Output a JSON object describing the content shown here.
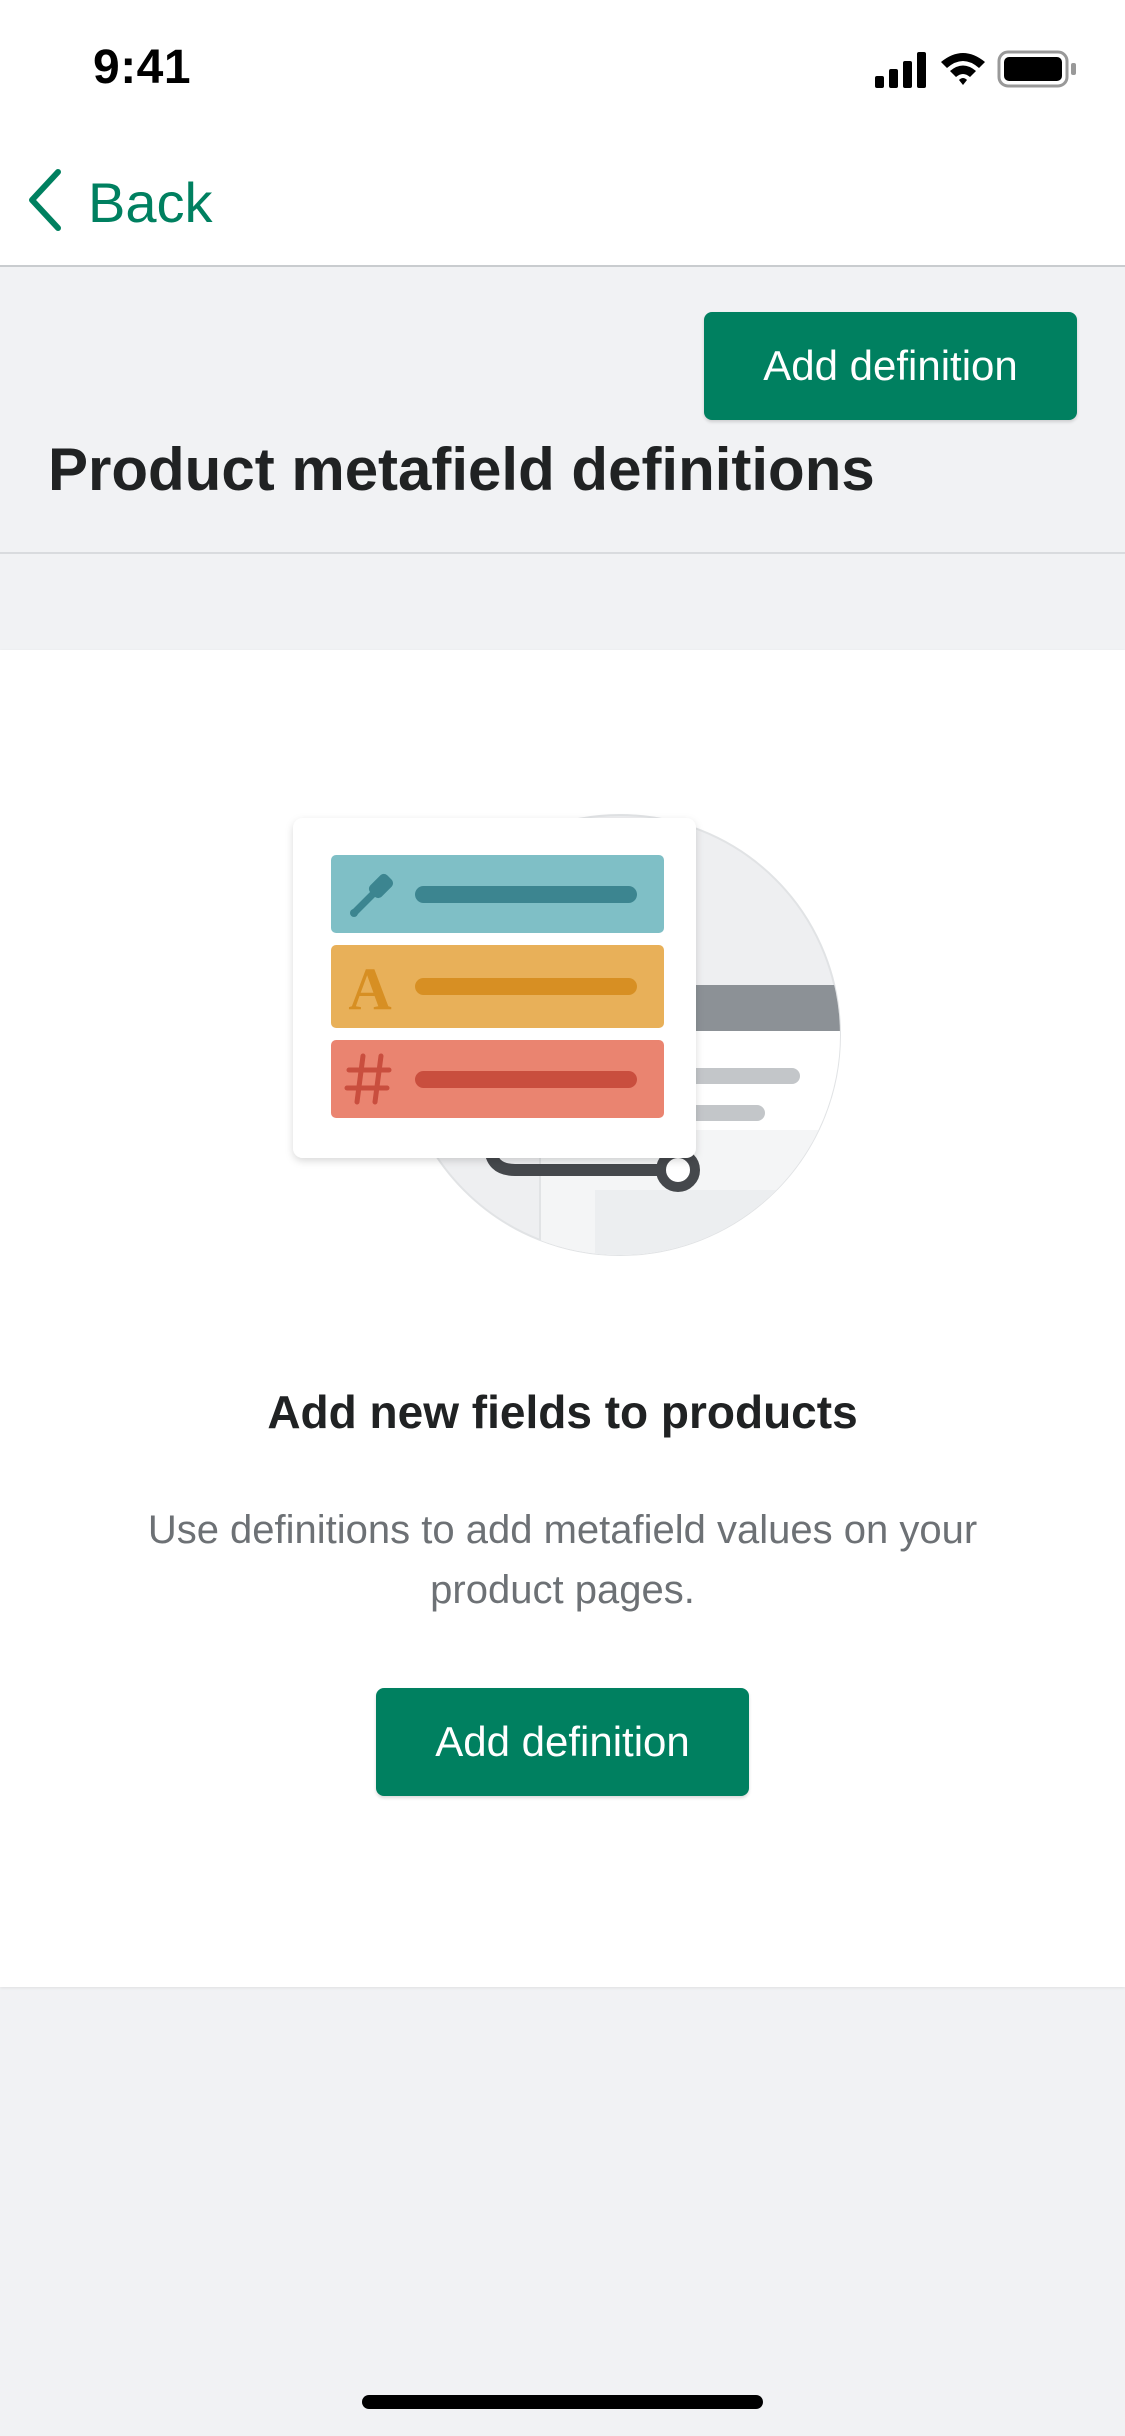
{
  "status_bar": {
    "time": "9:41"
  },
  "nav": {
    "back_label": "Back"
  },
  "header": {
    "add_button_label": "Add definition",
    "title": "Product metafield definitions"
  },
  "empty_state": {
    "heading": "Add new fields to products",
    "description": "Use definitions to add metafield values on your product pages.",
    "button_label": "Add definition"
  },
  "colors": {
    "primary": "#008060",
    "teal_row": "#7fbfc6",
    "yellow_row": "#e8b059",
    "red_row": "#ea8470"
  },
  "icons": {
    "back": "chevron-left-icon",
    "signal": "cellular-signal-icon",
    "wifi": "wifi-icon",
    "battery": "battery-icon",
    "eyedropper": "eyedropper-icon",
    "text": "letter-a-icon",
    "number": "hash-icon"
  }
}
